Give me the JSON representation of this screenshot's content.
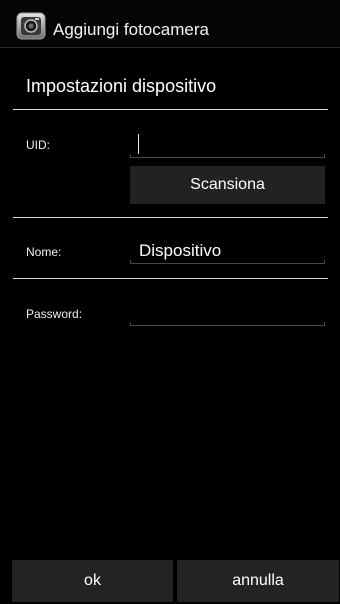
{
  "titlebar": {
    "icon": "camera-app-icon",
    "title": "Aggiungi fotocamera"
  },
  "section": {
    "title": "Impostazioni dispositivo"
  },
  "fields": {
    "uid": {
      "label": "UID:",
      "value": ""
    },
    "name": {
      "label": "Nome:",
      "value": "Dispositivo"
    },
    "password": {
      "label": "Password:",
      "value": ""
    }
  },
  "scan_button": {
    "label": "Scansiona"
  },
  "footer": {
    "ok_label": "ok",
    "cancel_label": "annulla"
  },
  "colors": {
    "background": "#000000",
    "button": "#222222",
    "divider": "#d7d7d7",
    "text": "#ffffff"
  }
}
